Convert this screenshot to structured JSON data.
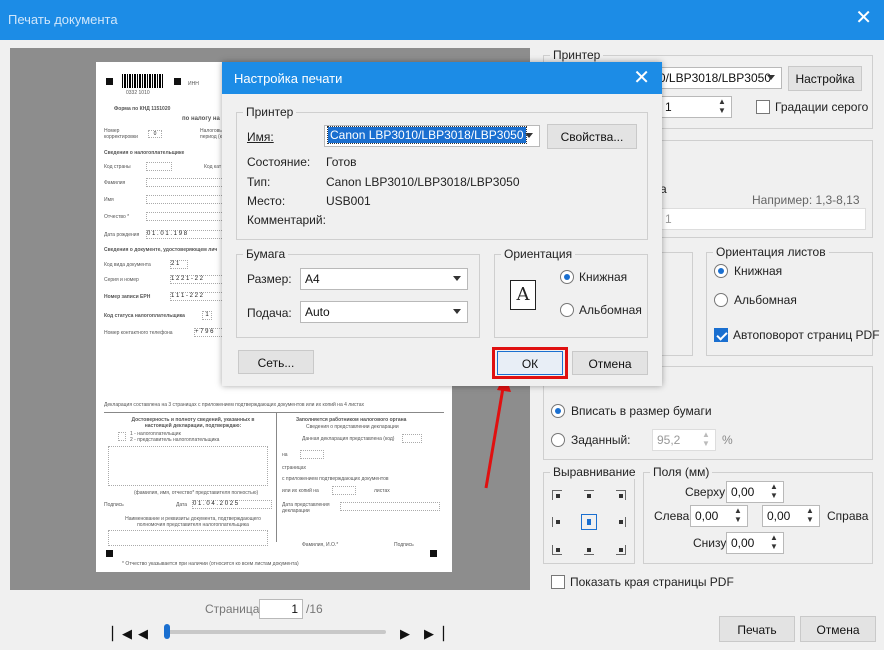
{
  "main": {
    "title": "Печать документа",
    "printer_group": "Принтер",
    "printer_name": "Canon LBP3010/LBP3018/LBP3050",
    "settings_button": "Настройка",
    "copies": "1",
    "grayscale_label": "Градации серого",
    "pages_label": "а",
    "example_text": "Например: 1,3-8,13",
    "pages_input_value": "1",
    "orientation_group": "Ориентация листов",
    "orient_portrait": "Книжная",
    "orient_landscape": "Альбомная",
    "autorotate_label": "Автоповорот страниц PDF",
    "fit_paper_label": "Вписать в размер бумаги",
    "custom_label": "Заданный:",
    "custom_value": "95,2",
    "custom_unit": "%",
    "align_group": "Выравнивание",
    "margins_group": "Поля (мм)",
    "margin_top_label": "Сверху",
    "margin_top_value": "0,00",
    "margin_left_label": "Слева",
    "margin_left_value": "0,00",
    "margin_right_label": "Справа",
    "margin_right_value": "0,00",
    "margin_bottom_label": "Снизу",
    "margin_bottom_value": "0,00",
    "show_edges_label": "Показать края страницы PDF",
    "print_button": "Печать",
    "cancel_button": "Отмена",
    "page_label": "Страница:",
    "page_current": "1",
    "page_total": "/16"
  },
  "dialog": {
    "title": "Настройка печати",
    "printer_group": "Принтер",
    "name_label": "Имя:",
    "name_value": "Canon LBP3010/LBP3018/LBP3050",
    "properties_button": "Свойства...",
    "status_label": "Состояние:",
    "status_value": "Готов",
    "type_label": "Тип:",
    "type_value": "Canon LBP3010/LBP3018/LBP3050",
    "location_label": "Место:",
    "location_value": "USB001",
    "comment_label": "Комментарий:",
    "paper_group": "Бумага",
    "size_label": "Размер:",
    "size_value": "A4",
    "source_label": "Подача:",
    "source_value": "Auto",
    "orientation_group": "Ориентация",
    "portrait_label": "Книжная",
    "landscape_label": "Альбомная",
    "orientation_glyph": "A",
    "network_button": "Сеть...",
    "ok_button": "ОК",
    "cancel_button": "Отмена"
  },
  "document": {
    "inn_label": "ИНН",
    "barcode_digits": "0332    1010",
    "form_title": "Форма по КНД 1151020",
    "tax_header": "по налогу на",
    "corr_number": "Номер корректировки",
    "corr_value": "0",
    "tax_period": "Налоговый период (код)",
    "taxpayer_info": "Сведения о налогоплательщике",
    "country_code": "Код страны",
    "code": "Код кат",
    "surname": "Фамилия",
    "name": "Имя",
    "patronymic": "Отчество *",
    "birth_date": "Дата рождения",
    "birth_value": "0 1 . 0 1 . 1 9 8",
    "id_doc": "Сведения о документе, удостоверяющем лич",
    "doc_type": "Код вида документа",
    "doc_type_value": "2 1",
    "series_number": "Серия и номер",
    "series_value": "1 2 2 1 - 2 2",
    "erp_number": "Номер записи ЕРН",
    "erp_value": "1 1 1 - 2 2 2",
    "status_code": "Код статуса налогоплательщика",
    "status_value": "1",
    "phone": "Номер контактного телефона",
    "phone_value": "+ 7 9 6",
    "declaration_line": "Декларация составлена на      3      страницах с приложением подтверждающих документов или их копий на      4      листах",
    "reliability": "Достоверность и полноту сведений, указанных в настоящей декларации, подтверждаю:",
    "option1": "1 - налогоплательщик",
    "option2": "2 - представитель налогоплательщика",
    "fio_sign": "(фамилия, имя, отчество* представителя полностью)",
    "sign": "Подпись",
    "date": "Дата",
    "date_value": "0 1 . 0 4 . 2 0 2 5",
    "rep_doc": "Наименование и реквизиты документа, подтверждающего полномочия представителя налогоплательщика",
    "tax_officer": "Заполняется работником налогового органа",
    "submission_info": "Сведения о представлении декларации",
    "submitted_code": "Данная декларация представлена (код)",
    "on": "на",
    "pages": "страницах",
    "with_docs": "с приложением подтверждающих документов",
    "or_copies": "или их копий на",
    "sheets": "листах",
    "submission_date": "Дата представления декларации",
    "fio": "Фамилия, И.О.*",
    "signature": "Подпись",
    "footnote": "* Отчество указывается при наличии (относится ко всем листам документа)"
  }
}
